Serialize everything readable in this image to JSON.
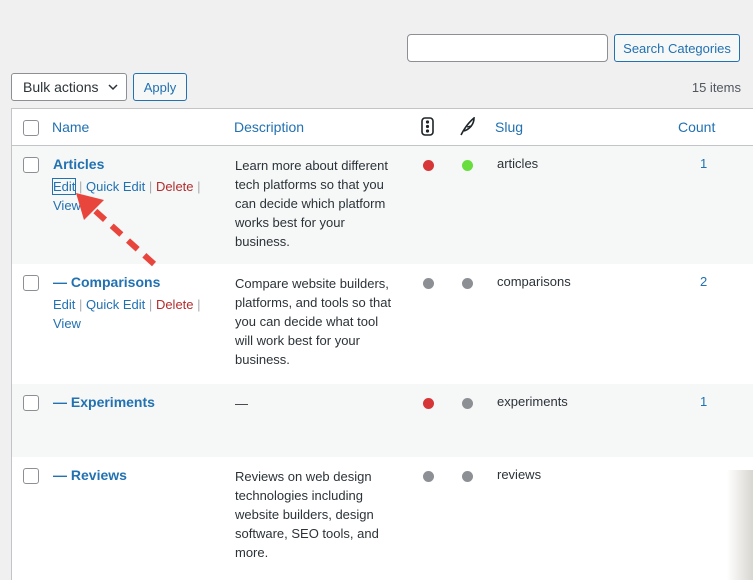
{
  "search": {
    "placeholder": "",
    "value": "",
    "button": "Search Categories"
  },
  "bulk": {
    "selected": "Bulk actions",
    "apply": "Apply"
  },
  "items_count": "15 items",
  "columns": {
    "name": "Name",
    "description": "Description",
    "col1_icon": "traffic-light-icon",
    "col2_icon": "feather-icon",
    "slug": "Slug",
    "count": "Count"
  },
  "rows": [
    {
      "name": "Articles",
      "actions": {
        "edit": "Edit",
        "quick_edit": "Quick Edit",
        "delete": "Delete",
        "view": "View"
      },
      "desc_lines": [
        "Learn more about different",
        "tech platforms so that you",
        "can decide which platform",
        "works best for your",
        "business."
      ],
      "dot1": "#d63638",
      "dot2": "#68de3e",
      "slug": "articles",
      "count": "1"
    },
    {
      "name": "— Comparisons",
      "actions": {
        "edit": "Edit",
        "quick_edit": "Quick Edit",
        "delete": "Delete",
        "view": "View"
      },
      "desc_lines": [
        "Compare website builders,",
        "platforms, and tools so that",
        "you can decide what tool",
        "will work best for your",
        "business."
      ],
      "dot1": "#8c8f94",
      "dot2": "#8c8f94",
      "slug": "comparisons",
      "count": "2"
    },
    {
      "name": "— Experiments",
      "desc_lines": [
        "—"
      ],
      "dot1": "#d63638",
      "dot2": "#8c8f94",
      "slug": "experiments",
      "count": "1"
    },
    {
      "name": "— Reviews",
      "desc_lines": [
        "Reviews on web design",
        "technologies including",
        "website builders, design",
        "software, SEO tools, and",
        "more."
      ],
      "dot1": "#8c8f94",
      "dot2": "#8c8f94",
      "slug": "reviews",
      "count": ""
    }
  ],
  "annotation": {
    "arrow_color": "#e8453c"
  }
}
